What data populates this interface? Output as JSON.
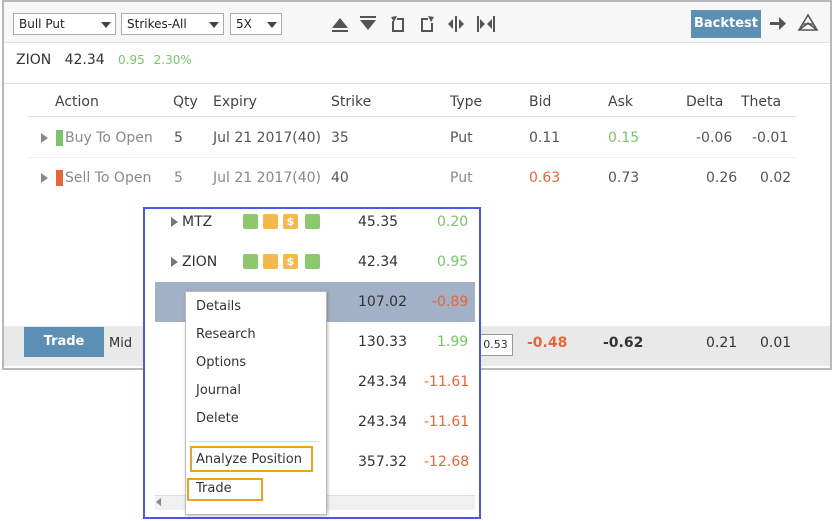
{
  "toolbar": {
    "strategy_select": "Bull Put",
    "strikes_select": "Strikes-All",
    "multiplier_select": "5X",
    "backtest_label": "Backtest"
  },
  "symbol": {
    "ticker": "ZION",
    "price": "42.34",
    "change": "0.95",
    "change_pct": "2.30%"
  },
  "table": {
    "headers": [
      "Action",
      "Qty",
      "Expiry",
      "Strike",
      "Type",
      "Bid",
      "Ask",
      "Delta",
      "Theta"
    ],
    "legs": [
      {
        "action": "Buy To Open",
        "qty": "5",
        "expiry": "Jul 21 2017(40)",
        "strike": "35",
        "type": "Put",
        "bid": "0.11",
        "ask": "0.15",
        "delta": "-0.06",
        "theta": "-0.01"
      },
      {
        "action": "Sell To Open",
        "qty": "5",
        "expiry": "Jul 21 2017(40)",
        "strike": "40",
        "type": "Put",
        "bid": "0.63",
        "ask": "0.73",
        "delta": "0.26",
        "theta": "0.02"
      }
    ]
  },
  "tradebar": {
    "trade_label": "Trade",
    "price_mode": "Mid",
    "limit_value": "0.53",
    "net_bid": "-0.48",
    "net_ask": "-0.62",
    "net_delta": "0.21",
    "net_theta": "0.01"
  },
  "watchlist": {
    "rows": [
      {
        "symbol": "MTZ",
        "price": "45.35",
        "change": "0.20"
      },
      {
        "symbol": "ZION",
        "price": "42.34",
        "change": "0.95"
      },
      {
        "symbol": "",
        "price": "107.02",
        "change": "-0.89"
      },
      {
        "symbol": "",
        "price": "130.33",
        "change": "1.99"
      },
      {
        "symbol": "",
        "price": "243.34",
        "change": "-11.61"
      },
      {
        "symbol": "",
        "price": "243.34",
        "change": "-11.61"
      },
      {
        "symbol": "",
        "price": "357.32",
        "change": "-12.68"
      }
    ],
    "badge_dollar": "$"
  },
  "context_menu": {
    "items": [
      "Details",
      "Research",
      "Options",
      "Journal",
      "Delete"
    ],
    "analyze_label": "Analyze Position",
    "trade_label": "Trade"
  },
  "colors": {
    "accent_blue": "#5b8fb3",
    "positive": "#7cc46a",
    "negative": "#e8643c",
    "popup_border": "#4a57e4",
    "highlight_orange": "#f0a11c",
    "selected_row": "#a3b1c6"
  }
}
